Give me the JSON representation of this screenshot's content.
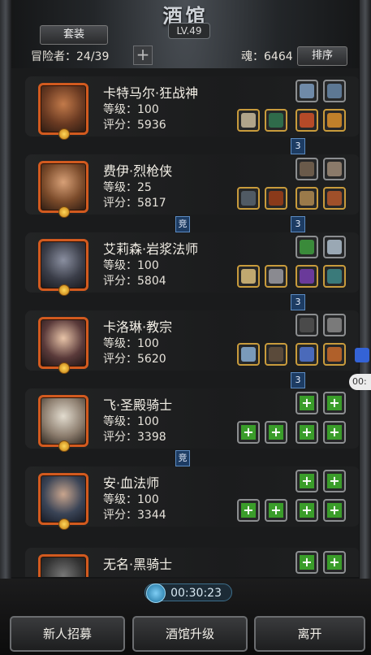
{
  "header": {
    "title": "酒馆",
    "level": "LV.49",
    "suit_button": "套装",
    "adventurers": "冒险者：24/39",
    "add_label": "+",
    "soul": "魂：6464",
    "sort_button": "排序"
  },
  "heroes": [
    {
      "name": "卡特马尔·狂战神",
      "level": "等级：100",
      "score": "评分：5936"
    },
    {
      "name": "费伊·烈枪侠",
      "level": "等级：25",
      "score": "评分：5817"
    },
    {
      "name": "艾莉森·岩浆法师",
      "level": "等级：100",
      "score": "评分：5804"
    },
    {
      "name": "卡洛琳·教宗",
      "level": "等级：100",
      "score": "评分：5620"
    },
    {
      "name": "飞·圣殿骑士",
      "level": "等级：100",
      "score": "评分：3398"
    },
    {
      "name": "安·血法师",
      "level": "等级：100",
      "score": "评分：3344"
    },
    {
      "name": "无名·黑骑士",
      "level": "",
      "score": ""
    }
  ],
  "tags": {
    "num3": "3",
    "arena": "竞"
  },
  "bottom": {
    "timer": "00:30:23",
    "recruit_button": "新人招募",
    "upgrade_button": "酒馆升级",
    "leave_button": "离开"
  },
  "side": {
    "timer": "00:"
  },
  "colors": {
    "portrait_border": "#d25a1f",
    "slot_gold": "#c89b3c",
    "empty_slot_plus": "#3a9d2a",
    "tag_blue": "#1d3c63"
  }
}
